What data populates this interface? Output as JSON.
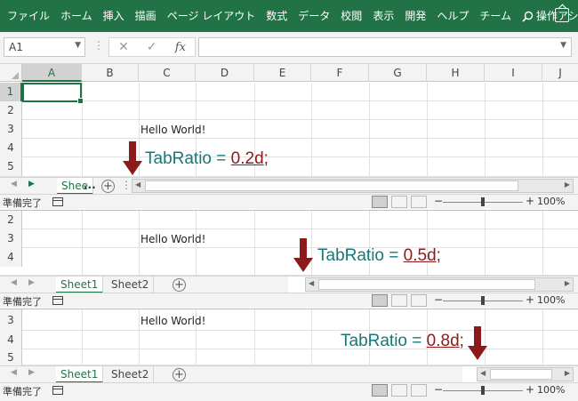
{
  "ribbon": {
    "tabs": [
      "ファイル",
      "ホーム",
      "挿入",
      "描画",
      "ページ レイアウト",
      "数式",
      "データ",
      "校閲",
      "表示",
      "開発",
      "ヘルプ",
      "チーム"
    ],
    "tell_me": "操作アシ",
    "accent": "#217346"
  },
  "formula_bar": {
    "name_box": "A1",
    "cancel_symbol": "✕",
    "enter_symbol": "✓",
    "fx_label": "fx",
    "formula_value": ""
  },
  "columns": [
    "A",
    "B",
    "C",
    "D",
    "E",
    "F",
    "G",
    "H",
    "I",
    "J"
  ],
  "cell_text": "Hello World!",
  "panels": [
    {
      "rows": [
        "1",
        "2",
        "3",
        "4",
        "5"
      ],
      "sheet_tabs": [
        "Shee"
      ],
      "ellipsis": "...",
      "annotation": {
        "prefix": "TabRatio = ",
        "value": "0.2d",
        "suffix": ";"
      },
      "tab_ratio": 0.2
    },
    {
      "rows": [
        "2",
        "3",
        "4"
      ],
      "sheet_tabs": [
        "Sheet1",
        "Sheet2"
      ],
      "annotation": {
        "prefix": "TabRatio = ",
        "value": "0.5d",
        "suffix": ";"
      },
      "tab_ratio": 0.5
    },
    {
      "rows": [
        "3",
        "4",
        "5"
      ],
      "sheet_tabs": [
        "Sheet1",
        "Sheet2"
      ],
      "annotation": {
        "prefix": "TabRatio = ",
        "value": "0.8d",
        "suffix": ";"
      },
      "tab_ratio": 0.8
    }
  ],
  "status_bar": {
    "ready": "準備完了",
    "zoom_minus": "−",
    "zoom_plus": "+",
    "zoom": "100%"
  },
  "colors": {
    "annotation_text": "#17787a",
    "annotation_value": "#8b1a1a",
    "arrow": "#8b1a1a"
  }
}
